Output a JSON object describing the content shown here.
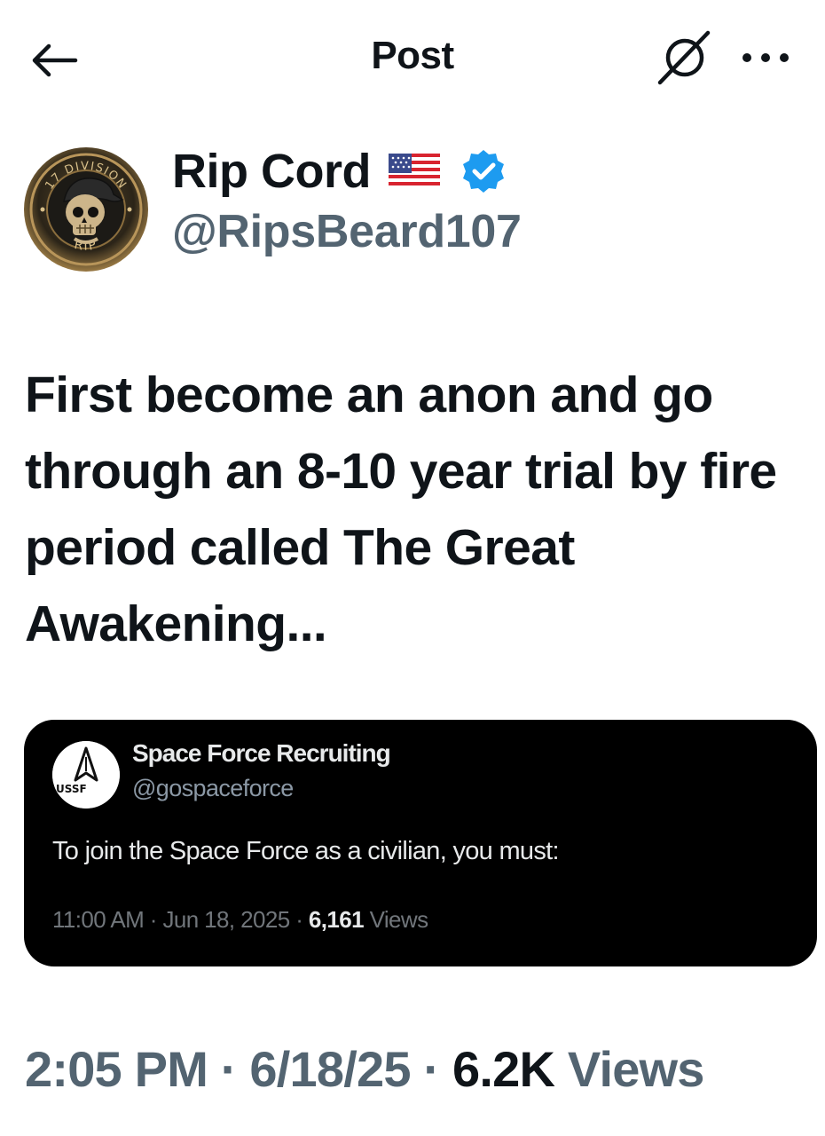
{
  "header": {
    "title": "Post",
    "back_icon": "arrow-left-icon",
    "grok_icon": "grok-icon",
    "more_icon": "more-horizontal-icon"
  },
  "author": {
    "display_name": "Rip Cord",
    "handle": "@RipsBeard107",
    "flag": "us-flag-icon",
    "verified": true,
    "verified_color": "#1d9bf0",
    "avatar_text_top": "17 DIVISION",
    "avatar_text_bottom": "RIP"
  },
  "post": {
    "text": "First become an anon and go through an 8-10 year trial by fire period called The Great Awakening..."
  },
  "quoted_image": {
    "name": "Space Force Recruiting",
    "handle": "@gospaceforce",
    "avatar_label": "USSF",
    "text": "To join the Space Force as a civilian, you must:",
    "time": "11:00 AM",
    "date": "Jun 18, 2025",
    "views_count": "6,161",
    "views_label": "Views"
  },
  "meta": {
    "time": "2:05 PM",
    "date": "6/18/25",
    "views_count": "6.2K",
    "views_label": "Views"
  },
  "colors": {
    "text_primary": "#0f1419",
    "text_secondary": "#536471",
    "accent": "#1d9bf0"
  }
}
